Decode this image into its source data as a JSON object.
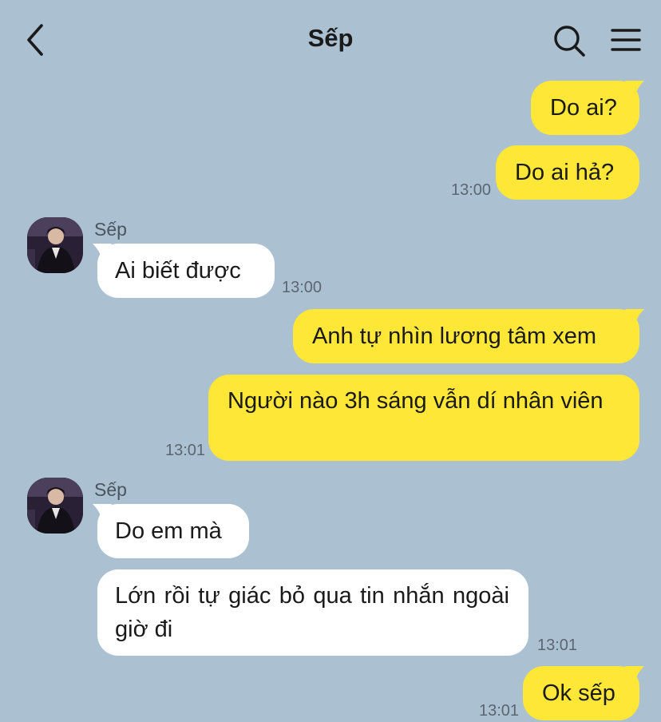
{
  "header": {
    "title": "Sếp",
    "back_icon": "chevron-left-icon",
    "search_icon": "search-icon",
    "menu_icon": "hamburger-menu-icon"
  },
  "colors": {
    "background": "#abc1d1",
    "my_bubble": "#fee736",
    "their_bubble": "#ffffff",
    "timestamp": "#5b6672"
  },
  "messages": [
    {
      "from": "me",
      "text": "Do ai?"
    },
    {
      "from": "me",
      "text": "Do ai hả?",
      "time": "13:00"
    },
    {
      "from": "them",
      "sender": "Sếp",
      "text": "Ai biết được",
      "time": "13:00"
    },
    {
      "from": "me",
      "text": "Anh tự nhìn lương tâm xem"
    },
    {
      "from": "me",
      "text": "Người nào 3h sáng vẫn dí nhân viên",
      "time": "13:01"
    },
    {
      "from": "them",
      "sender": "Sếp",
      "text": "Do em mà"
    },
    {
      "from": "them",
      "text": "Lớn rồi tự giác bỏ qua tin nhắn ngoài giờ đi",
      "time": "13:01"
    },
    {
      "from": "me",
      "text": "Ok sếp",
      "time": "13:01"
    }
  ]
}
